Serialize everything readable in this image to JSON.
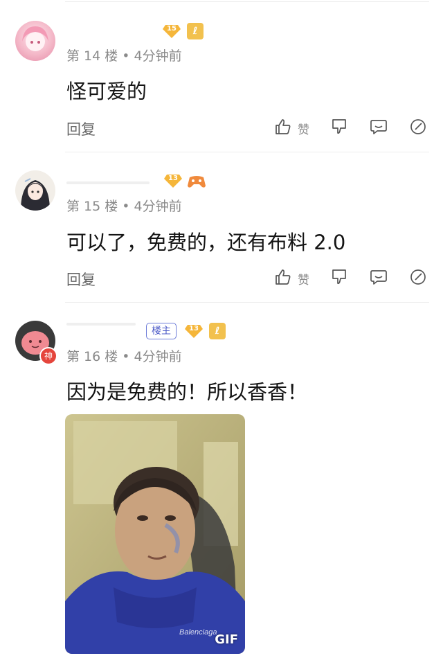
{
  "comments": [
    {
      "level": "15",
      "floor": "第 14 楼",
      "time": "4分钟前",
      "text": "怪可爱的",
      "reply": "回复",
      "like_label": "赞"
    },
    {
      "level": "13",
      "floor": "第 15 楼",
      "time": "4分钟前",
      "text": "可以了，免费的，还有布料 2.0",
      "reply": "回复",
      "like_label": "赞"
    },
    {
      "level": "13",
      "owner_tag": "楼主",
      "floor": "第 16 楼",
      "time": "4分钟前",
      "text": "因为是免费的！所以香香！",
      "avatar_badge": "神",
      "gif_label": "GIF"
    }
  ],
  "colors": {
    "level_badge": "#f5b63a",
    "special_badge": "#f2c14e",
    "owner_tag": "#5b68d0",
    "meta_text": "#8a8a8a"
  },
  "icons": [
    "thumbs-up-icon",
    "thumbs-down-icon",
    "message-icon",
    "share-icon"
  ]
}
